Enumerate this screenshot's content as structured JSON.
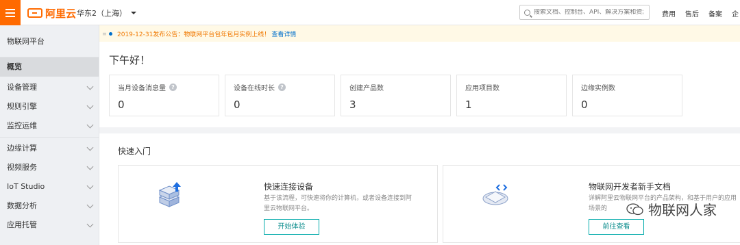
{
  "topbar": {
    "logo_text": "阿里云",
    "region": "华东2（上海）",
    "search_placeholder": "搜索文档、控制台、API、解决方案和资源",
    "links": [
      "费用",
      "售后",
      "备案",
      "企"
    ]
  },
  "sidebar": {
    "title": "物联网平台",
    "active_item": "概览",
    "groups": [
      [
        "设备管理",
        "规则引擎",
        "监控运维"
      ],
      [
        "边缘计算",
        "视频服务",
        "IoT Studio",
        "数据分析",
        "应用托管"
      ]
    ]
  },
  "notice": {
    "text": "2019-12-31发布公告：物联网平台包年包月实例上线！",
    "link": "查看详情"
  },
  "main": {
    "greeting": "下午好！",
    "stats": [
      {
        "label": "当月设备消息量",
        "value": "0",
        "help": true
      },
      {
        "label": "设备在线时长",
        "value": "0",
        "help": true
      },
      {
        "label": "创建产品数",
        "value": "3",
        "help": false
      },
      {
        "label": "应用项目数",
        "value": "1",
        "help": false
      },
      {
        "label": "边缘实例数",
        "value": "0",
        "help": false
      }
    ]
  },
  "quick": {
    "title": "快速入门",
    "cards": [
      {
        "title": "快速连接设备",
        "desc": "基于该流程，可快速将你的计算机，或者设备连接到阿里云物联网平台。",
        "button": "开始体验"
      },
      {
        "title": "物联网开发者新手文档",
        "desc": "详解阿里云物联网平台的产品架构，和基于用户的应用场景的",
        "button": "前往查看"
      }
    ]
  },
  "watermark": "物联网人家",
  "colors": {
    "brand": "#ff6a00",
    "link": "#0070cc",
    "notice": "#f07800",
    "button": "#00aaaa"
  }
}
